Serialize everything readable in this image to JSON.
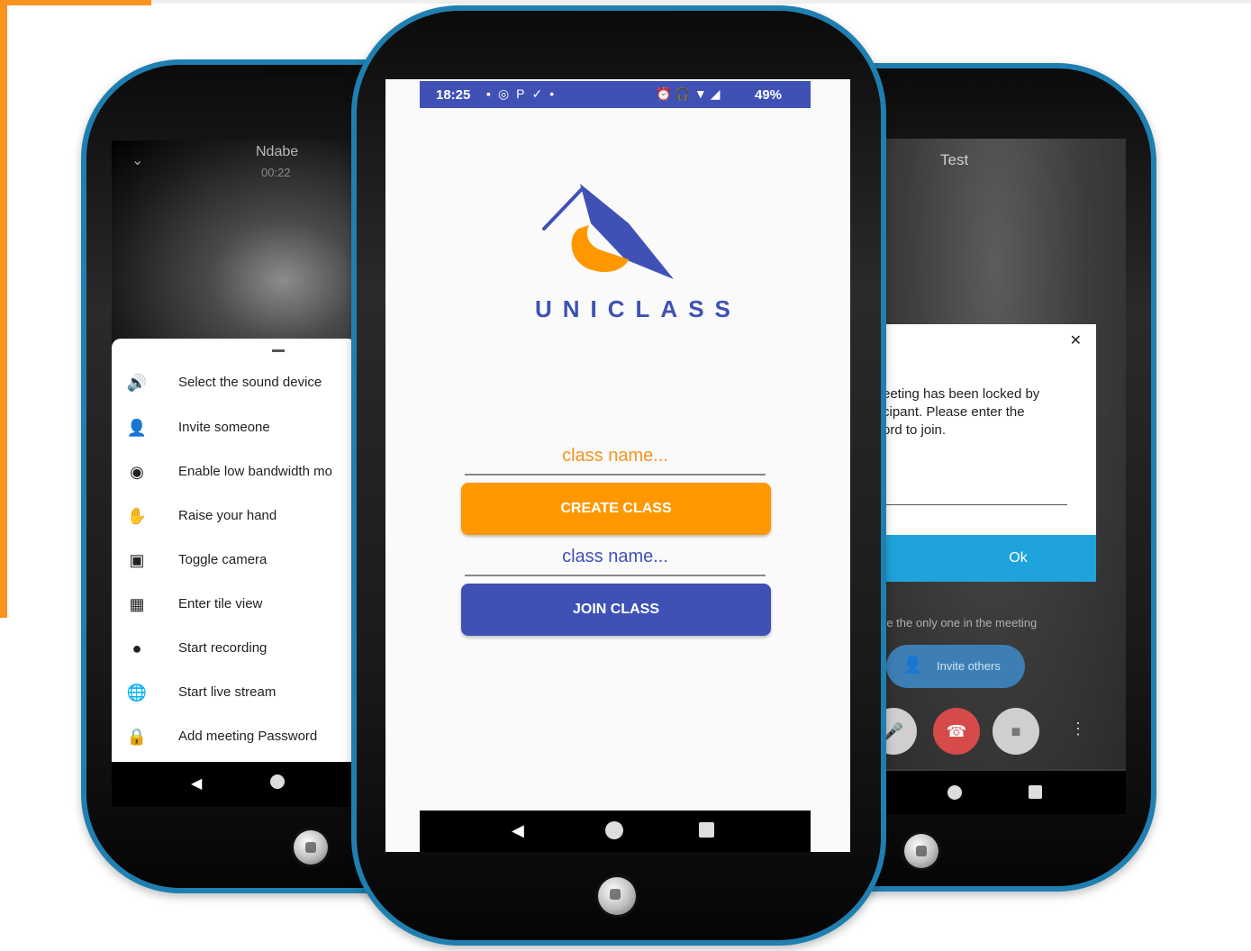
{
  "left_phone": {
    "caller_name": "Ndabe",
    "call_timer": "00:22",
    "menu_items": [
      {
        "label": "Select the sound device",
        "icon": "speaker-icon"
      },
      {
        "label": "Invite someone",
        "icon": "add-person-icon"
      },
      {
        "label": "Enable low bandwidth mo",
        "icon": "eye-icon"
      },
      {
        "label": "Raise your hand",
        "icon": "hand-icon"
      },
      {
        "label": "Toggle camera",
        "icon": "camera-switch-icon"
      },
      {
        "label": "Enter tile view",
        "icon": "tile-grid-icon"
      },
      {
        "label": "Start recording",
        "icon": "record-dot-icon"
      },
      {
        "label": "Start live stream",
        "icon": "globe-icon"
      },
      {
        "label": "Add meeting Password",
        "icon": "lock-icon"
      }
    ]
  },
  "center_phone": {
    "status_bar": {
      "time": "18:25",
      "battery": "49%"
    },
    "brand": "UNICLASS",
    "create_field_placeholder": "class name...",
    "create_button": "CREATE CLASS",
    "join_field_placeholder": "class name...",
    "join_button": "JOIN CLASS",
    "colors": {
      "primary": "#3f51b5",
      "accent": "#ff9800"
    }
  },
  "right_phone": {
    "meeting_title": "Test",
    "dialog_text_lines": [
      "eeting has been locked by",
      "cipant. Please enter the",
      "ord to join."
    ],
    "dialog_ok": "Ok",
    "alone_message": "re the only one in the meeting",
    "invite_button": "Invite others"
  }
}
